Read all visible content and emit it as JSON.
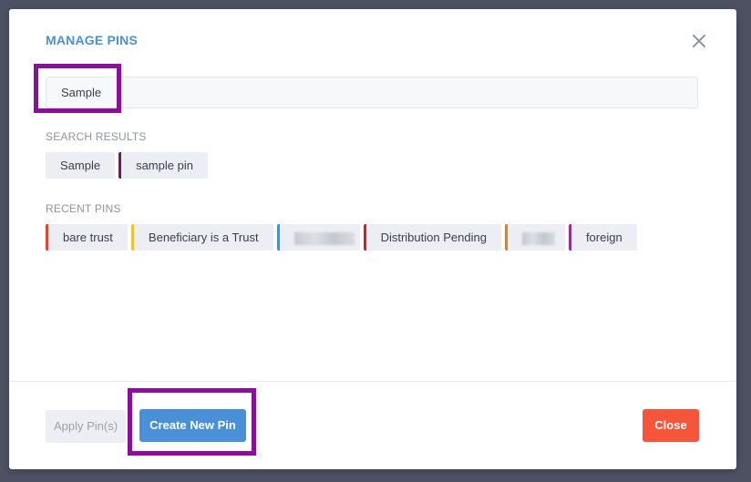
{
  "modal": {
    "title": "MANAGE PINS",
    "close_icon": "close-icon"
  },
  "search": {
    "value": "Sample"
  },
  "search_results": {
    "label": "SEARCH RESULTS",
    "items": [
      {
        "label": "Sample",
        "color": ""
      },
      {
        "label": "sample pin",
        "color": "#5a2a4a"
      }
    ]
  },
  "recent_pins": {
    "label": "RECENT PINS",
    "items": [
      {
        "label": "bare trust",
        "color": "#e0453a"
      },
      {
        "label": "Beneficiary is a Trust",
        "color": "#f0c12c"
      },
      {
        "label": "",
        "color": "#4a90d9",
        "redacted": true
      },
      {
        "label": "Distribution Pending",
        "color": "#d32020"
      },
      {
        "label": "",
        "color": "#c08a4a",
        "redacted": true
      },
      {
        "label": "foreign",
        "color": "#9b2a9b"
      }
    ]
  },
  "footer": {
    "apply_label": "Apply Pin(s)",
    "create_label": "Create New Pin",
    "close_label": "Close"
  },
  "colors": {
    "accent": "#4a90d9",
    "danger": "#f4553b",
    "highlight": "#8b0f9a"
  }
}
